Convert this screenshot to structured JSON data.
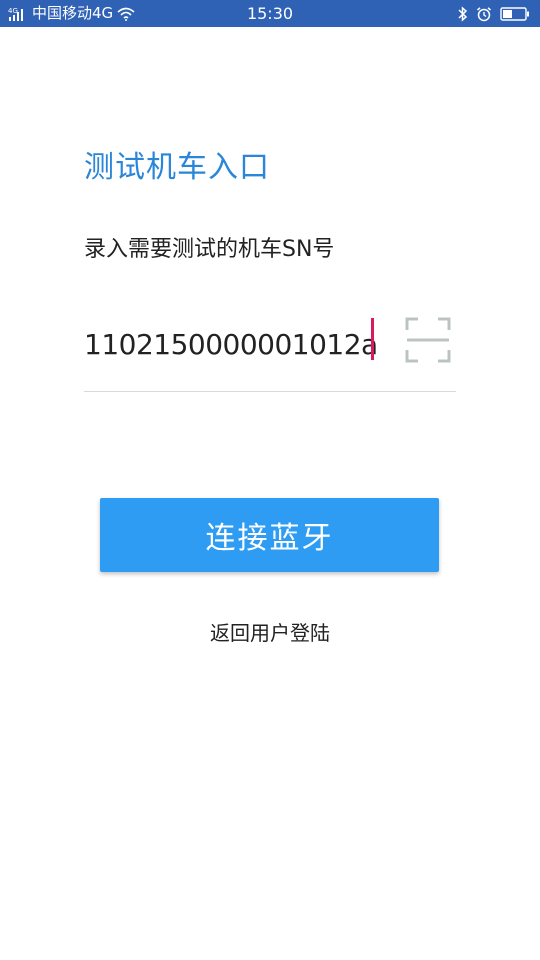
{
  "status_bar": {
    "carrier": "中国移动4G",
    "time": "15:30",
    "signal_icon": "signal-icon",
    "wifi_icon": "wifi-icon",
    "bluetooth_icon": "bluetooth-icon",
    "alarm_icon": "alarm-icon",
    "battery_icon": "battery-icon",
    "background_color": "#2f62b5"
  },
  "main": {
    "title": "测试机车入口",
    "subtitle": "录入需要测试的机车SN号",
    "sn_input": {
      "value": "1102150000001012a"
    },
    "scan_icon": "scan-icon",
    "connect_button_label": "连接蓝牙",
    "back_link_label": "返回用户登陆"
  },
  "colors": {
    "accent": "#2a86d8",
    "button": "#2d9cf2",
    "caret": "#d81b60"
  }
}
